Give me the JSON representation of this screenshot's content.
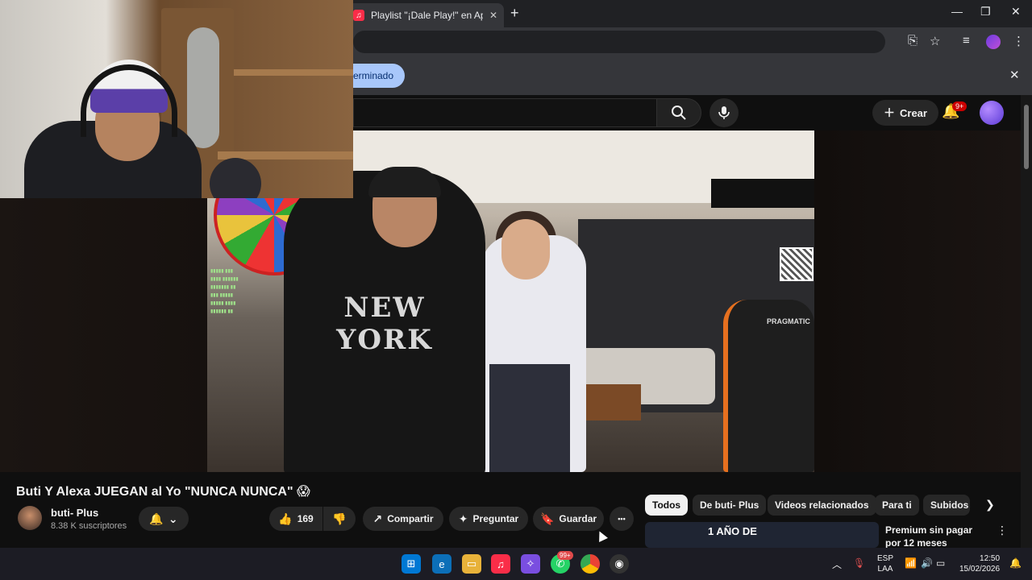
{
  "browser": {
    "tab_title": "Playlist \"¡Dale Play!\" en Apple M",
    "tab_close": "✕",
    "new_tab": "+",
    "infobar_pill": "erminado",
    "infobar_close": "✕"
  },
  "youtube": {
    "create_label": "Crear",
    "notif_badge": "9+",
    "video_title": "Buti Y Alexa JUEGAN al Yo \"NUNCA NUNCA\" 😱",
    "channel_name": "buti- Plus",
    "subscribers": "8.38 K suscriptores",
    "like_count": "169",
    "share_label": "Compartir",
    "ask_label": "Preguntar",
    "save_label": "Guardar",
    "more_label": "•••",
    "video_shirt_text": "NEW YORK",
    "video_chair_text": "PRAGMATIC",
    "chips": [
      "Todos",
      "De buti- Plus",
      "Videos relacionados",
      "Para ti",
      "Subidos r"
    ],
    "suggestion": {
      "thumb_text": "1 AÑO DE",
      "title": "Premium sin pagar por 12 meses"
    }
  },
  "taskbar": {
    "whatsapp_badge": "99+",
    "lang_line1": "ESP",
    "lang_line2": "LAA",
    "time": "12:50",
    "date": "15/02/2026"
  },
  "colors": {
    "youtube_bg": "#0f0f0f",
    "chip_active": "#f1f1f1",
    "pill_blue": "#a8c7fa",
    "badge_red": "#cc0000"
  }
}
